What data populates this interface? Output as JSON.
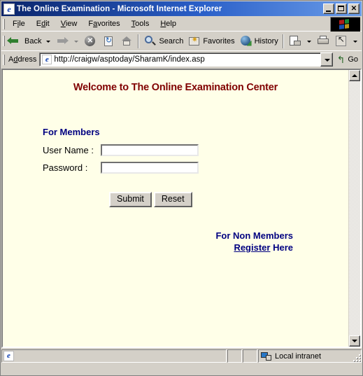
{
  "window": {
    "title": "The Online Examination - Microsoft Internet Explorer",
    "icon": "ie-document-icon",
    "minimize_label": "_",
    "maximize_label": "",
    "close_label": "✕"
  },
  "menubar": {
    "items": [
      {
        "pre": "F",
        "key": "i",
        "post": "le",
        "name": "menu-file"
      },
      {
        "pre": "E",
        "key": "d",
        "post": "it",
        "name": "menu-edit"
      },
      {
        "pre": "",
        "key": "V",
        "post": "iew",
        "name": "menu-view"
      },
      {
        "pre": "F",
        "key": "a",
        "post": "vorites",
        "name": "menu-favorites"
      },
      {
        "pre": "",
        "key": "T",
        "post": "ools",
        "name": "menu-tools"
      },
      {
        "pre": "",
        "key": "H",
        "post": "elp",
        "name": "menu-help"
      }
    ]
  },
  "toolbar": {
    "back": "Back",
    "forward": "",
    "stop_glyph": "✕",
    "search": "Search",
    "favorites": "Favorites",
    "history": "History",
    "overflow": "»"
  },
  "address": {
    "label_pre": "A",
    "label_key": "d",
    "label_post": "dress",
    "url": "http://craigw/asptoday/SharamK/index.asp",
    "placeholder": "",
    "go_label": "Go"
  },
  "page": {
    "heading": "Welcome to The Online Examination Center",
    "members_heading": "For Members",
    "fields": [
      {
        "label": "User Name :",
        "value": "",
        "name": "username"
      },
      {
        "label": "Password :",
        "value": "",
        "name": "password"
      }
    ],
    "submit_label": "Submit",
    "reset_label": "Reset",
    "non_members_heading": "For Non Members",
    "register_link": "Register",
    "register_suffix": " Here",
    "background_color": "#ffffe8",
    "heading_color": "#800000",
    "accent_color": "#000080"
  },
  "statusbar": {
    "message": "",
    "zone": "Local intranet",
    "zone_icon": "local-intranet-icon"
  }
}
